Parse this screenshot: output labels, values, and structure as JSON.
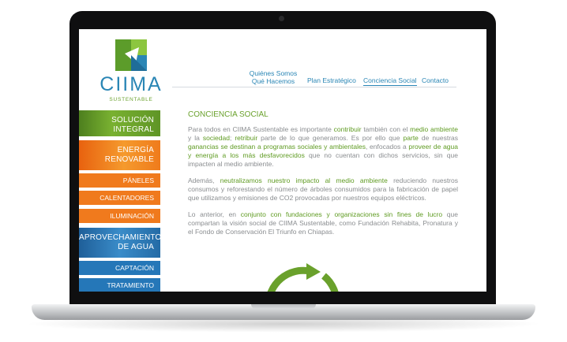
{
  "brand": {
    "name": "CIIMA",
    "tagline": "SUSTENTABLE",
    "colors": {
      "green": "#6aa12c",
      "blue": "#2a86b5",
      "orange": "#f07a1d"
    }
  },
  "nav": {
    "quienes": "Quiénes Somos",
    "que": "Qué Hacemos",
    "plan": "Plan Estratégico",
    "conciencia": "Conciencia Social",
    "contacto": "Contacto",
    "active": "Conciencia Social"
  },
  "sidebar": {
    "solucion_1": "SOLUCIÓN",
    "solucion_2": "INTEGRAL",
    "energia_1": "ENERGÍA",
    "energia_2": "RENOVABLE",
    "paneles": "PÁNELES",
    "calentadores": "CALENTADORES",
    "iluminacion": "ILUMINACIÓN",
    "agua_1": "APROVECHAMIENTO",
    "agua_2": "DE AGUA",
    "captacion": "CAPTACIÓN",
    "tratamiento": "TRATAMIENTO"
  },
  "content": {
    "title": "CONCIENCIA SOCIAL",
    "p1": [
      {
        "t": "Para todos en CIIMA Sustentable es importante ",
        "h": false
      },
      {
        "t": "contribuir",
        "h": true
      },
      {
        "t": " también con el ",
        "h": false
      },
      {
        "t": "medio ambiente",
        "h": true
      },
      {
        "t": " y la ",
        "h": false
      },
      {
        "t": "sociedad",
        "h": true
      },
      {
        "t": "; ",
        "h": false
      },
      {
        "t": "retribuir",
        "h": true
      },
      {
        "t": " parte de lo que generamos. Es por ello que ",
        "h": false
      },
      {
        "t": "parte",
        "h": true
      },
      {
        "t": " de nuestras ",
        "h": false
      },
      {
        "t": "ganancias se destinan a programas sociales y ambientales",
        "h": true
      },
      {
        "t": ", enfocados a ",
        "h": false
      },
      {
        "t": "proveer de agua y energía a los más desfavorecidos",
        "h": true
      },
      {
        "t": " que no cuentan con dichos servicios, sin que impacten al medio ambiente.",
        "h": false
      }
    ],
    "p2": [
      {
        "t": "Además, ",
        "h": false
      },
      {
        "t": "neutralizamos nuestro impacto al medio ambiente",
        "h": true
      },
      {
        "t": " reduciendo nuestros consumos y reforestando el número de árboles consumidos para la fabricación de papel que utilizamos y emisiones de CO2 provocadas por nuestros equipos eléctricos.",
        "h": false
      }
    ],
    "p3": [
      {
        "t": "Lo anterior, en ",
        "h": false
      },
      {
        "t": "conjunto con fundaciones y organizaciones sin fines de lucro",
        "h": true
      },
      {
        "t": " que compartan la visión social de CIIMA Sustentable, como Fundación Rehabita, Pronatura y el Fondo de Conservación El Triunfo en Chiapas.",
        "h": false
      }
    ]
  },
  "icons": [
    "logo-mark",
    "recycle-arrows-icon",
    "globe-icon"
  ]
}
